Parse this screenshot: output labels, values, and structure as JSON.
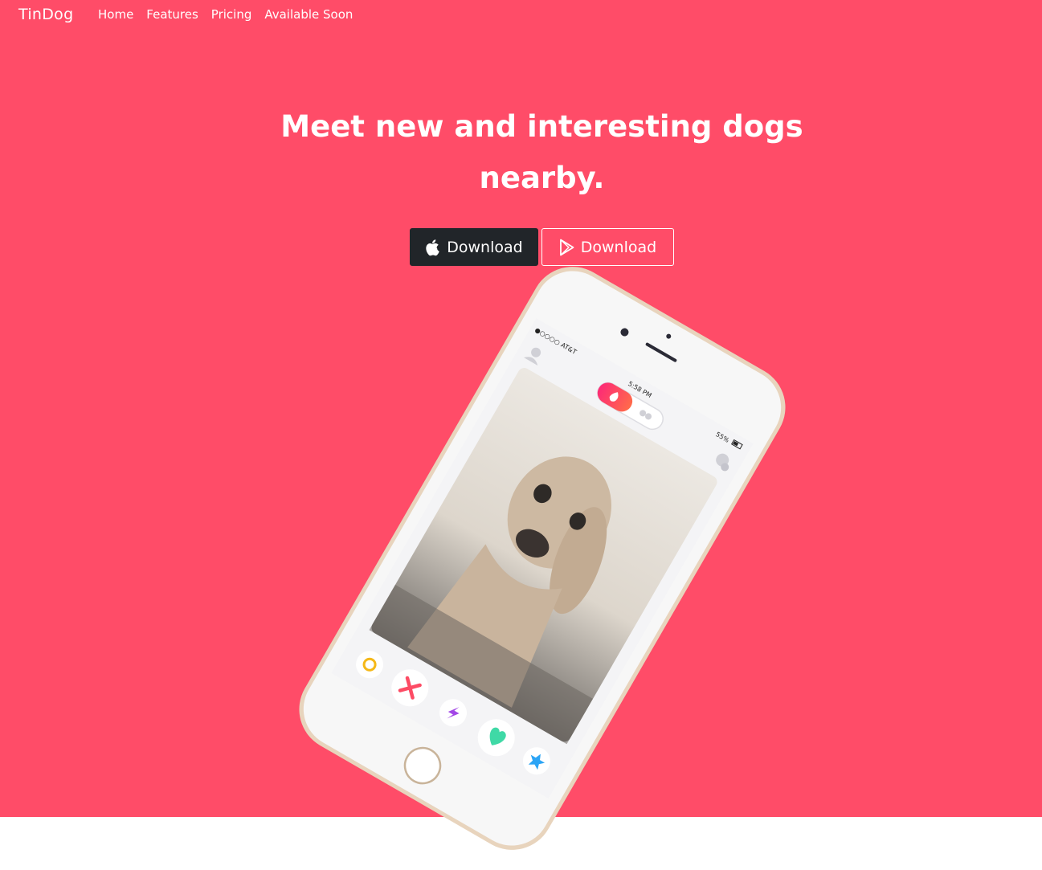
{
  "navbar": {
    "brand": "TinDog",
    "links": [
      {
        "label": "Home"
      },
      {
        "label": "Features"
      },
      {
        "label": "Pricing"
      },
      {
        "label": "Available Soon"
      }
    ]
  },
  "hero": {
    "headline": "Meet new and interesting dogs nearby.",
    "background_color": "#ff4c68",
    "buttons": [
      {
        "label": "Download",
        "icon": "apple-icon",
        "style": "dark"
      },
      {
        "label": "Download",
        "icon": "google-play-icon",
        "style": "outline-light"
      }
    ]
  },
  "phone": {
    "status_bar": {
      "carrier": "●○○○○ AT&T",
      "time": "5:58 PM",
      "battery": "55%"
    },
    "action_buttons": [
      "rewind-icon",
      "nope-icon",
      "boost-icon",
      "like-icon",
      "super-like-icon"
    ]
  }
}
